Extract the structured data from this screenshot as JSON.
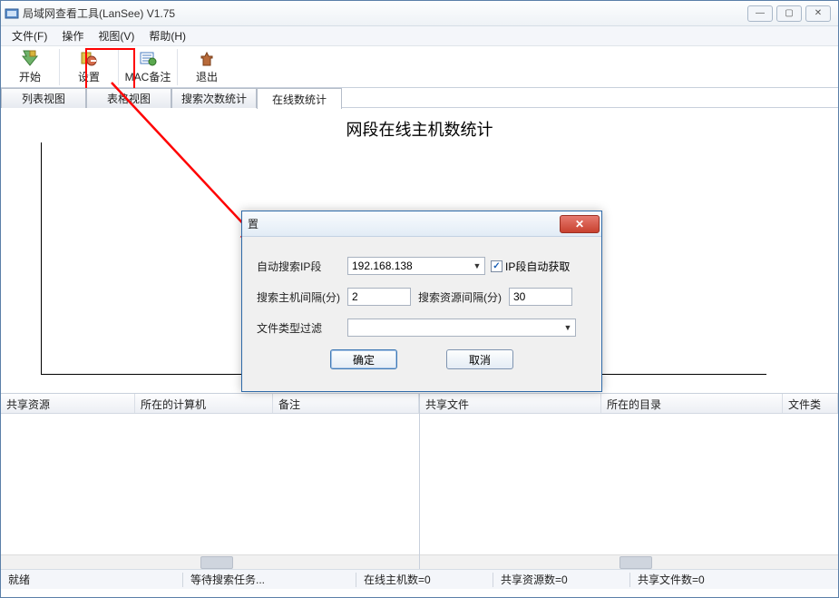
{
  "window": {
    "title": "局域网查看工具(LanSee) V1.75"
  },
  "menu": {
    "file": "文件(F)",
    "op": "操作",
    "view": "视图(V)",
    "help": "帮助(H)"
  },
  "toolbar": {
    "start": "开始",
    "settings": "设置",
    "mac": "MAC备注",
    "exit": "退出"
  },
  "tabs": {
    "list": "列表视图",
    "grid": "表格视图",
    "search": "搜索次数统计",
    "online": "在线数统计"
  },
  "chart": {
    "title": "网段在线主机数统计"
  },
  "left_panel": {
    "c1": "共享资源",
    "c2": "所在的计算机",
    "c3": "备注"
  },
  "right_panel": {
    "c1": "共享文件",
    "c2": "所在的目录",
    "c3": "文件类"
  },
  "status": {
    "ready": "就绪",
    "waiting": "等待搜索任务...",
    "online": "在线主机数=0",
    "share_res": "共享资源数=0",
    "share_file": "共享文件数=0"
  },
  "dialog": {
    "title_frag": "置",
    "row1_label": "自动搜索IP段",
    "ip": "192.168.138",
    "auto_ip": "IP段自动获取",
    "row2_label1": "搜索主机间隔(分)",
    "host_interval": "2",
    "row2_label2": "搜索资源间隔(分)",
    "res_interval": "30",
    "row3_label": "文件类型过滤",
    "ok": "确定",
    "cancel": "取消"
  },
  "chart_data": {
    "type": "bar",
    "title": "网段在线主机数统计",
    "categories": [],
    "values": [],
    "xlabel": "",
    "ylabel": ""
  }
}
